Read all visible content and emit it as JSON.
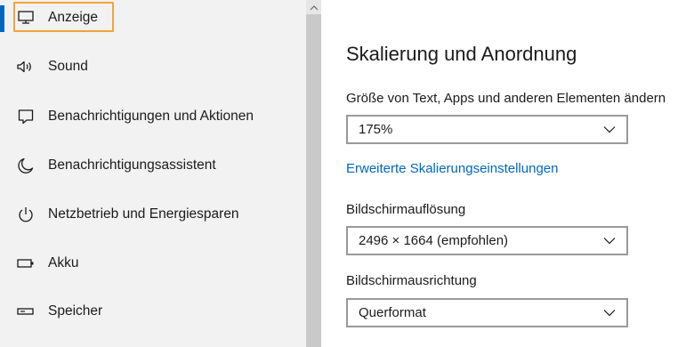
{
  "sidebar": {
    "items": [
      {
        "label": "Anzeige",
        "icon": "monitor-icon",
        "active": true
      },
      {
        "label": "Sound",
        "icon": "speaker-icon"
      },
      {
        "label": "Benachrichtigungen und Aktionen",
        "icon": "notification-icon"
      },
      {
        "label": "Benachrichtigungsassistent",
        "icon": "moon-icon"
      },
      {
        "label": "Netzbetrieb und Energiesparen",
        "icon": "power-icon"
      },
      {
        "label": "Akku",
        "icon": "battery-icon"
      },
      {
        "label": "Speicher",
        "icon": "storage-icon"
      }
    ]
  },
  "main": {
    "section_title": "Skalierung und Anordnung",
    "scale": {
      "label": "Größe von Text, Apps und anderen Elementen ändern",
      "value": "175%"
    },
    "advanced_link": "Erweiterte Skalierungseinstellungen",
    "resolution": {
      "label": "Bildschirmauflösung",
      "value": "2496 × 1664 (empfohlen)"
    },
    "orientation": {
      "label": "Bildschirmausrichtung",
      "value": "Querformat"
    }
  },
  "colors": {
    "accent": "#0067c0",
    "focus": "#f2a33a",
    "sidebar_bg": "#f2f2f2"
  }
}
